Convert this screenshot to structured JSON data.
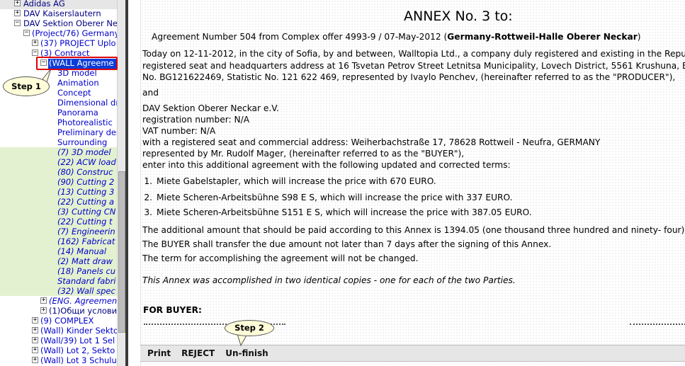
{
  "tree": {
    "items": [
      {
        "toggle": "+",
        "label": "Adidas AG"
      },
      {
        "toggle": "+",
        "label": "DAV Kaiserslautern"
      },
      {
        "toggle": "−",
        "label": "DAV Sektion Oberer Ne"
      },
      {
        "toggle": "−",
        "label": "(Project/76) Germany"
      },
      {
        "toggle": "+",
        "label": "(37) PROJECT Uplo"
      },
      {
        "toggle": "−",
        "label": "(3) Contract"
      },
      {
        "toggle": "−",
        "label": "(WALL Agreeme"
      },
      {
        "label": "3D model"
      },
      {
        "label": "Animation"
      },
      {
        "label": "Concept"
      },
      {
        "label": "Dimensional dra"
      },
      {
        "label": "Panorama"
      },
      {
        "label": "Photorealistic"
      },
      {
        "label": "Preliminary des"
      },
      {
        "label": "Surrounding"
      },
      {
        "label": "(7) 3D model"
      },
      {
        "label": "(22) ACW load"
      },
      {
        "label": "(80) Construc"
      },
      {
        "label": "(90) Cutting 2"
      },
      {
        "label": "(13) Cutting 3"
      },
      {
        "label": "(22) Cutting a"
      },
      {
        "label": "(3) Cutting CN"
      },
      {
        "label": "(22) Cutting t"
      },
      {
        "label": "(7) Engineerin"
      },
      {
        "label": "(162) Fabricat"
      },
      {
        "label": "(14) Manual"
      },
      {
        "label": "(2) Matt draw"
      },
      {
        "label": "(18) Panels cu"
      },
      {
        "label": "Standard fabri"
      },
      {
        "label": "(32) Wall spec"
      },
      {
        "toggle": "+",
        "label": "(ENG. Agreemen"
      },
      {
        "toggle": "+",
        "label": "(1)Общи услови"
      },
      {
        "toggle": "+",
        "label": "(9) COMPLEX"
      },
      {
        "toggle": "+",
        "label": "(Wall) Kinder Sektor"
      },
      {
        "toggle": "+",
        "label": "(Wall/39) Lot 1 Sel"
      },
      {
        "toggle": "+",
        "label": "(Wall) Lot 2, Sekto"
      },
      {
        "toggle": "+",
        "label": "(Wall) Lot 3 Schulu"
      }
    ]
  },
  "callouts": {
    "step1": "Step 1",
    "step2": "Step 2"
  },
  "document": {
    "title": "ANNEX No. 3 to:",
    "agreement_prefix": "Agreement Number 504 from Complex offer 4993-9 / 07-May-2012 (",
    "agreement_bold": "Germany-Rottweil-Halle Oberer Neckar",
    "agreement_suffix": ")",
    "intro_lines": [
      "Today on 12-11-2012, in the city of Sofia, by and between, Walltopia Ltd., a company duly registered and existing in the Republic of Bu",
      "registered seat and headquarters address at 16 Tsvetan Petrov Street Letnitsa Municipality, Lovech District, 5561 Krushuna, Bulgaria V",
      "No. BG121622469, Statistic No. 121 622 469, represented by Ivaylo Penchev, (hereinafter referred to as the \"PRODUCER\"),"
    ],
    "and": "and",
    "buyer_lines": [
      "DAV Sektion Oberer Neckar e.V.",
      "registration number: N/A",
      "VAT number: N/A",
      "with a registered seat and commercial address: Weiherbachstraße 17, 78628 Rottweil - Neufra, GERMANY",
      "represented by Mr. Rudolf Mager, (hereinafter referred to as the \"BUYER\"),",
      "enter into this additional agreement with the following updated and corrected terms:"
    ],
    "terms": [
      {
        "num": "1.",
        "text": "Miete Gabelstapler, which will increase the price with 670 EURO."
      },
      {
        "num": "2.",
        "text": "Miete Scheren-Arbeitsbühne S98 E S, which will increase the price with 337 EURO."
      },
      {
        "num": "3.",
        "text": "Miete Scheren-Arbeitsbühne S151 E S, which will increase the price with 387.05 EURO."
      }
    ],
    "additional_amount": "The additional amount that should be paid according to this Annex is 1394.05 (one thousand three hundred and ninety- four) EURO.",
    "transfer": "The BUYER shall transfer the due amount not later than 7 days after the signing of this Annex.",
    "term": "The term for accomplishing the agreement will not be changed.",
    "copies": "This Annex was accomplished in two identical copies - one for each of the two Parties.",
    "for_buyer": "FOR BUYER:"
  },
  "toolbar": {
    "print": "Print",
    "reject": "REJECT",
    "unfinish": "Un-finish"
  },
  "colors": {
    "highlight_outline": "#e00000",
    "selection": "#0a3cd8",
    "green_band": "#e3f1d0",
    "tree_link": "#0000cc"
  }
}
